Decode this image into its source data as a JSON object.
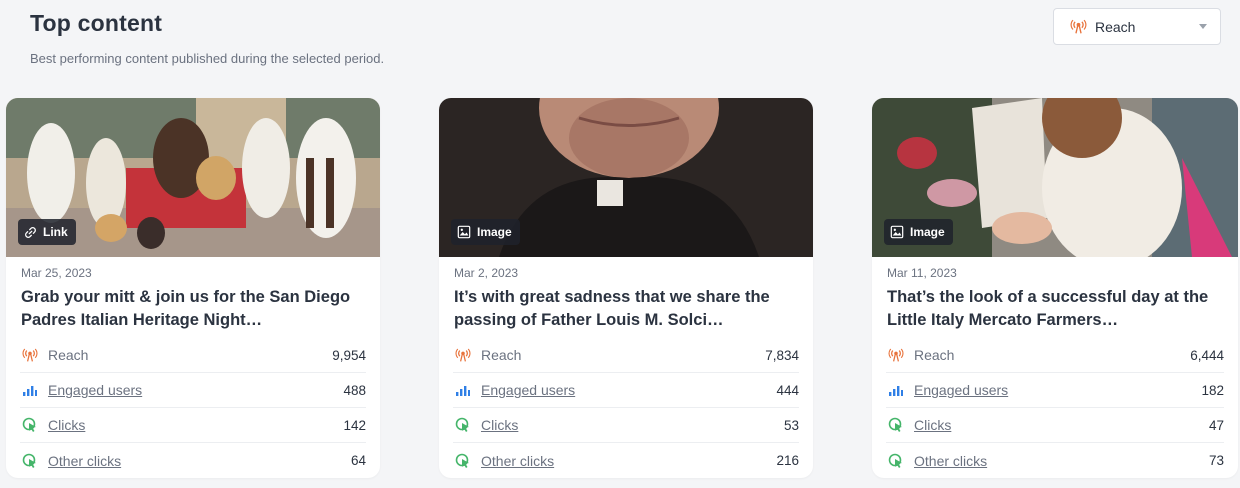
{
  "header": {
    "title": "Top content",
    "subtitle": "Best performing content published during the selected period."
  },
  "sort_dropdown": {
    "selected": "Reach",
    "icon": "broadcast-icon"
  },
  "colors": {
    "reach": "#e8733c",
    "engaged": "#2f7fe6",
    "clicks": "#45b56a",
    "text_dark": "#2b3340",
    "text_muted": "#6b7280"
  },
  "cards": [
    {
      "type": "Link",
      "type_icon": "link-icon",
      "image_desc": "padres-photo",
      "date": "Mar 25, 2023",
      "title": "Grab your mitt & join us for the San Diego Padres Italian Heritage Night…",
      "metrics": [
        {
          "label": "Reach",
          "value": "9,954"
        },
        {
          "label": "Engaged users",
          "value": "488"
        },
        {
          "label": "Clicks",
          "value": "142"
        },
        {
          "label": "Other clicks",
          "value": "64"
        }
      ]
    },
    {
      "type": "Image",
      "type_icon": "image-icon",
      "image_desc": "priest-photo",
      "date": "Mar 2, 2023",
      "title": "It’s with great sadness that we share the passing of Father Louis M. Solci…",
      "metrics": [
        {
          "label": "Reach",
          "value": "7,834"
        },
        {
          "label": "Engaged users",
          "value": "444"
        },
        {
          "label": "Clicks",
          "value": "53"
        },
        {
          "label": "Other clicks",
          "value": "216"
        }
      ]
    },
    {
      "type": "Image",
      "type_icon": "image-icon",
      "image_desc": "mercato-photo",
      "date": "Mar 11, 2023",
      "title": "That’s the look of a successful day at the Little Italy Mercato Farmers…",
      "metrics": [
        {
          "label": "Reach",
          "value": "6,444"
        },
        {
          "label": "Engaged users",
          "value": "182"
        },
        {
          "label": "Clicks",
          "value": "47"
        },
        {
          "label": "Other clicks",
          "value": "73"
        }
      ]
    }
  ]
}
